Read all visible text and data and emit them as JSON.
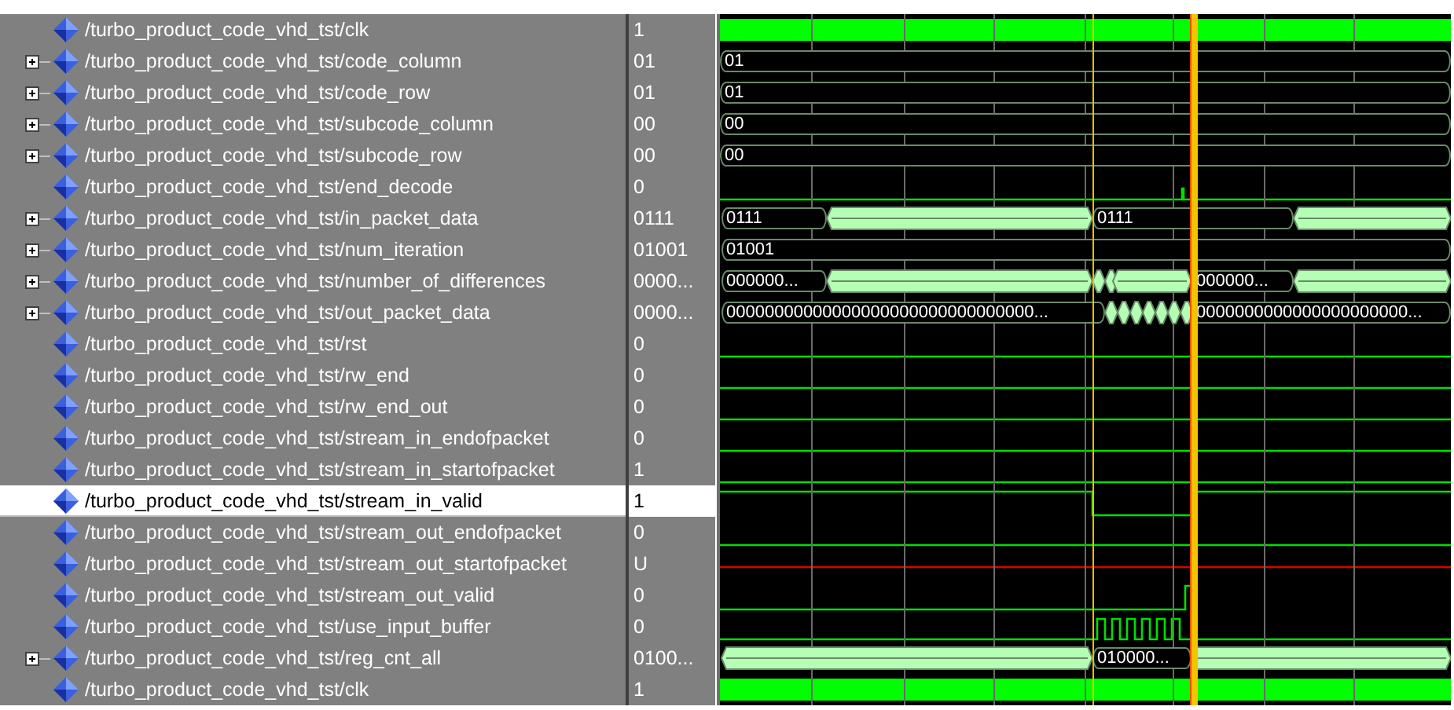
{
  "signals": [
    {
      "name": "/turbo_product_code_vhd_tst/clk",
      "value": "1",
      "expandable": false,
      "selected": false,
      "kind": "clock"
    },
    {
      "name": "/turbo_product_code_vhd_tst/code_column",
      "value": "01",
      "expandable": true,
      "selected": false,
      "kind": "bus",
      "wave_labels": [
        "01"
      ]
    },
    {
      "name": "/turbo_product_code_vhd_tst/code_row",
      "value": "01",
      "expandable": true,
      "selected": false,
      "kind": "bus",
      "wave_labels": [
        "01"
      ]
    },
    {
      "name": "/turbo_product_code_vhd_tst/subcode_column",
      "value": "00",
      "expandable": true,
      "selected": false,
      "kind": "bus",
      "wave_labels": [
        "00"
      ]
    },
    {
      "name": "/turbo_product_code_vhd_tst/subcode_row",
      "value": "00",
      "expandable": true,
      "selected": false,
      "kind": "bus",
      "wave_labels": [
        "00"
      ]
    },
    {
      "name": "/turbo_product_code_vhd_tst/end_decode",
      "value": "0",
      "expandable": false,
      "selected": false,
      "kind": "bit"
    },
    {
      "name": "/turbo_product_code_vhd_tst/in_packet_data",
      "value": "0111",
      "expandable": true,
      "selected": false,
      "kind": "bus",
      "wave_labels": [
        "0111",
        "0111"
      ]
    },
    {
      "name": "/turbo_product_code_vhd_tst/num_iteration",
      "value": "01001",
      "expandable": true,
      "selected": false,
      "kind": "bus",
      "wave_labels": [
        "01001"
      ]
    },
    {
      "name": "/turbo_product_code_vhd_tst/number_of_differences",
      "value": "0000...",
      "expandable": true,
      "selected": false,
      "kind": "bus",
      "wave_labels": [
        "000000...",
        "000000..."
      ]
    },
    {
      "name": "/turbo_product_code_vhd_tst/out_packet_data",
      "value": "0000...",
      "expandable": true,
      "selected": false,
      "kind": "bus",
      "wave_labels": [
        "00000000000000000000000000000000...",
        "0000000000000000000000..."
      ]
    },
    {
      "name": "/turbo_product_code_vhd_tst/rst",
      "value": "0",
      "expandable": false,
      "selected": false,
      "kind": "bit"
    },
    {
      "name": "/turbo_product_code_vhd_tst/rw_end",
      "value": "0",
      "expandable": false,
      "selected": false,
      "kind": "bit"
    },
    {
      "name": "/turbo_product_code_vhd_tst/rw_end_out",
      "value": "0",
      "expandable": false,
      "selected": false,
      "kind": "bit"
    },
    {
      "name": "/turbo_product_code_vhd_tst/stream_in_endofpacket",
      "value": "0",
      "expandable": false,
      "selected": false,
      "kind": "bit"
    },
    {
      "name": "/turbo_product_code_vhd_tst/stream_in_startofpacket",
      "value": "1",
      "expandable": false,
      "selected": false,
      "kind": "bit"
    },
    {
      "name": "/turbo_product_code_vhd_tst/stream_in_valid",
      "value": "1",
      "expandable": false,
      "selected": true,
      "kind": "bit"
    },
    {
      "name": "/turbo_product_code_vhd_tst/stream_out_endofpacket",
      "value": "0",
      "expandable": false,
      "selected": false,
      "kind": "bit"
    },
    {
      "name": "/turbo_product_code_vhd_tst/stream_out_startofpacket",
      "value": "U",
      "expandable": false,
      "selected": false,
      "kind": "unknown"
    },
    {
      "name": "/turbo_product_code_vhd_tst/stream_out_valid",
      "value": "0",
      "expandable": false,
      "selected": false,
      "kind": "bit"
    },
    {
      "name": "/turbo_product_code_vhd_tst/use_input_buffer",
      "value": "0",
      "expandable": false,
      "selected": false,
      "kind": "bit"
    },
    {
      "name": "/turbo_product_code_vhd_tst/reg_cnt_all",
      "value": "0100...",
      "expandable": true,
      "selected": false,
      "kind": "bus",
      "wave_labels": [
        "010000..."
      ]
    },
    {
      "name": "/turbo_product_code_vhd_tst/clk",
      "value": "1",
      "expandable": false,
      "selected": false,
      "kind": "clock"
    }
  ]
}
